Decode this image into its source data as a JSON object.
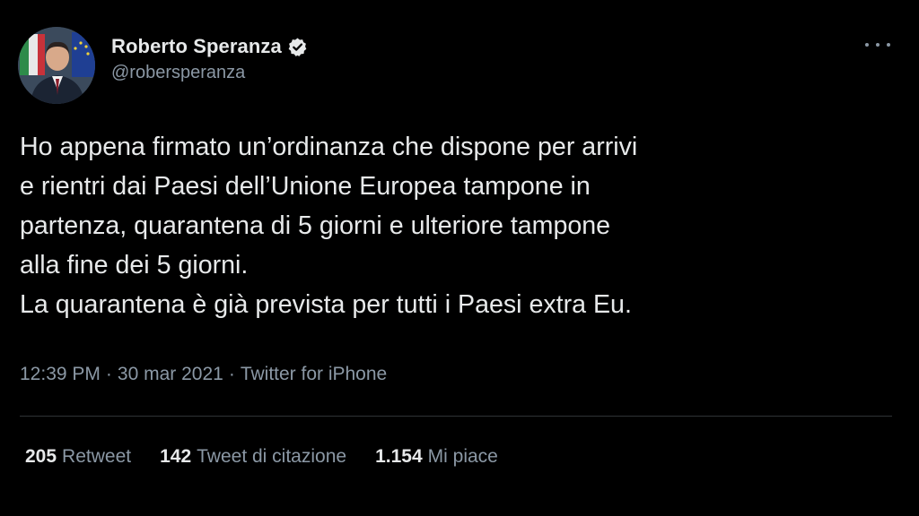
{
  "author": {
    "display_name": "Roberto Speranza",
    "handle": "@robersperanza",
    "verified": true
  },
  "menu": {
    "icon": "more-horizontal-icon"
  },
  "tweet": {
    "lines": [
      "Ho appena firmato un’ordinanza che dispone per arrivi",
      "e rientri dai Paesi dell’Unione Europea tampone in",
      "partenza, quarantena di 5 giorni e ulteriore tampone",
      "alla fine dei 5 giorni.",
      "La quarantena è già prevista per tutti i Paesi extra Eu."
    ]
  },
  "meta": {
    "time": "12:39 PM",
    "separator": "·",
    "date": "30 mar 2021",
    "source": "Twitter for iPhone"
  },
  "stats": {
    "retweets": {
      "count": "205",
      "label": "Retweet"
    },
    "quotes": {
      "count": "142",
      "label": "Tweet di citazione"
    },
    "likes": {
      "count": "1.154",
      "label": "Mi piace"
    }
  },
  "colors": {
    "background": "#000000",
    "text": "#e7e9ea",
    "secondary_text": "#8b98a5",
    "divider": "#2f3336",
    "verified_badge": "#e7e9ea"
  }
}
